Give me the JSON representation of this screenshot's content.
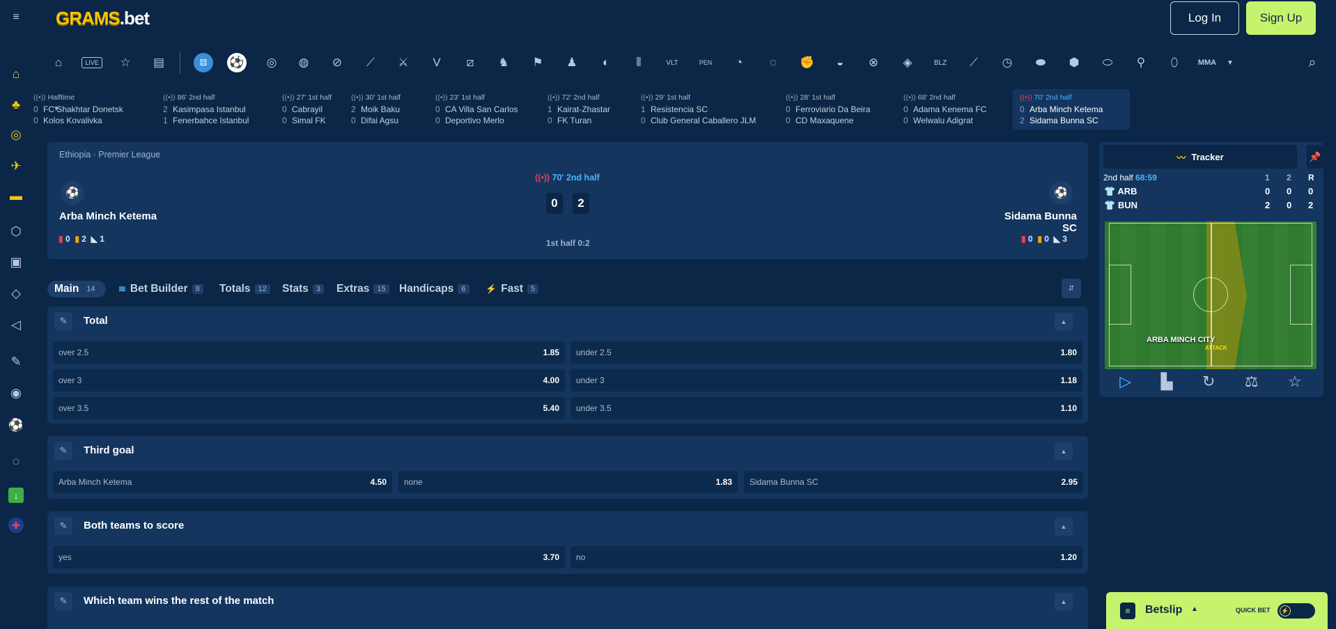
{
  "header": {
    "logo_grams": "GRAMS",
    "logo_bet": ".bet",
    "login_label": "Log In",
    "signup_label": "Sign Up"
  },
  "sidebar": {
    "items": [
      "home-icon",
      "slots-icon",
      "casino-icon",
      "rocket-icon",
      "tv-games-icon",
      "promo-icon",
      "gift-icon",
      "vip-diamond-icon",
      "megaphone-icon",
      "ticket-icon",
      "virtual-icon",
      "football-icon",
      "chat-icon",
      "download-icon",
      "flag-uk-icon"
    ]
  },
  "sports_nav": {
    "items": [
      "home",
      "live",
      "favorites",
      "betslip-history",
      "esports",
      "football",
      "live-football",
      "basketball",
      "tennis",
      "hockey",
      "counter-strike",
      "valorant",
      "dota",
      "chess",
      "racing",
      "fifa",
      "volleyball",
      "other",
      "volta",
      "penalty",
      "table-tennis",
      "ping",
      "fist",
      "handball",
      "cricket",
      "badminton",
      "american-football",
      "tennis-2",
      "bowling",
      "snooker",
      "rugby",
      "nba2k",
      "ice-hockey-2",
      "mma"
    ],
    "mma_label": "MMA"
  },
  "ticker": [
    {
      "status": "Halftime",
      "t1": "FC Shakhtar Donetsk",
      "s1": "0",
      "t2": "Kolos Kovalivka",
      "s2": "0"
    },
    {
      "status": "86' 2nd half",
      "t1": "Kasimpasa Istanbul",
      "s1": "2",
      "t2": "Fenerbahce Istanbul",
      "s2": "1"
    },
    {
      "status": "27' 1st half",
      "t1": "Cabrayil",
      "s1": "0",
      "t2": "Simal FK",
      "s2": "0"
    },
    {
      "status": "30' 1st half",
      "t1": "Moik Baku",
      "s1": "2",
      "t2": "Difai Agsu",
      "s2": "0"
    },
    {
      "status": "23' 1st half",
      "t1": "CA Villa San Carlos",
      "s1": "0",
      "t2": "Deportivo Merlo",
      "s2": "0"
    },
    {
      "status": "72' 2nd half",
      "t1": "Kairat-Zhastar",
      "s1": "1",
      "t2": "FK Turan",
      "s2": "0"
    },
    {
      "status": "29' 1st half",
      "t1": "Resistencia SC",
      "s1": "1",
      "t2": "Club General Caballero JLM",
      "s2": "0"
    },
    {
      "status": "28' 1st half",
      "t1": "Ferroviario Da Beira",
      "s1": "0",
      "t2": "CD Maxaquene",
      "s2": "0"
    },
    {
      "status": "68' 2nd half",
      "t1": "Adama Kenema FC",
      "s1": "0",
      "t2": "Welwalu Adigrat",
      "s2": "0"
    },
    {
      "status": "70' 2nd half",
      "t1": "Arba Minch Ketema",
      "s1": "0",
      "t2": "Sidama Bunna SC",
      "s2": "2"
    }
  ],
  "match": {
    "league": "Ethiopia · Premier League",
    "status": "70' 2nd half",
    "home": "Arba Minch Ketema",
    "away": "Sidama Bunna SC",
    "home_score": "0",
    "away_score": "2",
    "score_sep": ":",
    "half_score": "1st half 0:2",
    "home_stats": {
      "red": "0",
      "yellow": "2",
      "corners": "1"
    },
    "away_stats": {
      "red": "0",
      "yellow": "0",
      "corners": "3"
    }
  },
  "tabs": [
    {
      "label": "Main",
      "count": "14"
    },
    {
      "label": "Bet Builder",
      "count": "8"
    },
    {
      "label": "Totals",
      "count": "12"
    },
    {
      "label": "Stats",
      "count": "3"
    },
    {
      "label": "Extras",
      "count": "15"
    },
    {
      "label": "Handicaps",
      "count": "6"
    },
    {
      "label": "Fast",
      "count": "5"
    }
  ],
  "markets": {
    "total": {
      "title": "Total",
      "rows": [
        [
          {
            "label": "over 2.5",
            "odd": "1.85"
          },
          {
            "label": "under 2.5",
            "odd": "1.80"
          }
        ],
        [
          {
            "label": "over 3",
            "odd": "4.00"
          },
          {
            "label": "under 3",
            "odd": "1.18"
          }
        ],
        [
          {
            "label": "over 3.5",
            "odd": "5.40"
          },
          {
            "label": "under 3.5",
            "odd": "1.10"
          }
        ]
      ]
    },
    "third_goal": {
      "title": "Third goal",
      "options": [
        {
          "label": "Arba Minch Ketema",
          "odd": "4.50"
        },
        {
          "label": "none",
          "odd": "1.83"
        },
        {
          "label": "Sidama Bunna SC",
          "odd": "2.95"
        }
      ]
    },
    "btts": {
      "title": "Both teams to score",
      "options": [
        {
          "label": "yes",
          "odd": "3.70"
        },
        {
          "label": "no",
          "odd": "1.20"
        }
      ]
    },
    "rest_of_match": {
      "title": "Which team wins the rest of the match"
    }
  },
  "tracker": {
    "title": "Tracker",
    "period": "2nd half",
    "clock": "68:59",
    "col1": "1",
    "col2": "2",
    "colR": "R",
    "home_abbr": "ARB",
    "away_abbr": "BUN",
    "home_vals": [
      "0",
      "0",
      "0"
    ],
    "away_vals": [
      "2",
      "0",
      "2"
    ],
    "attack_team": "ARBA MINCH CITY",
    "attack_label": "ATTACK"
  },
  "betslip": {
    "label": "Betslip",
    "quick_bet": "QUICK BET"
  },
  "colors": {
    "bg": "#0b2646",
    "panel": "#13355e",
    "accent": "#c6f36d",
    "gold": "#f7c600",
    "live_red": "#e7425c",
    "live_blue": "#4fb3ff"
  }
}
